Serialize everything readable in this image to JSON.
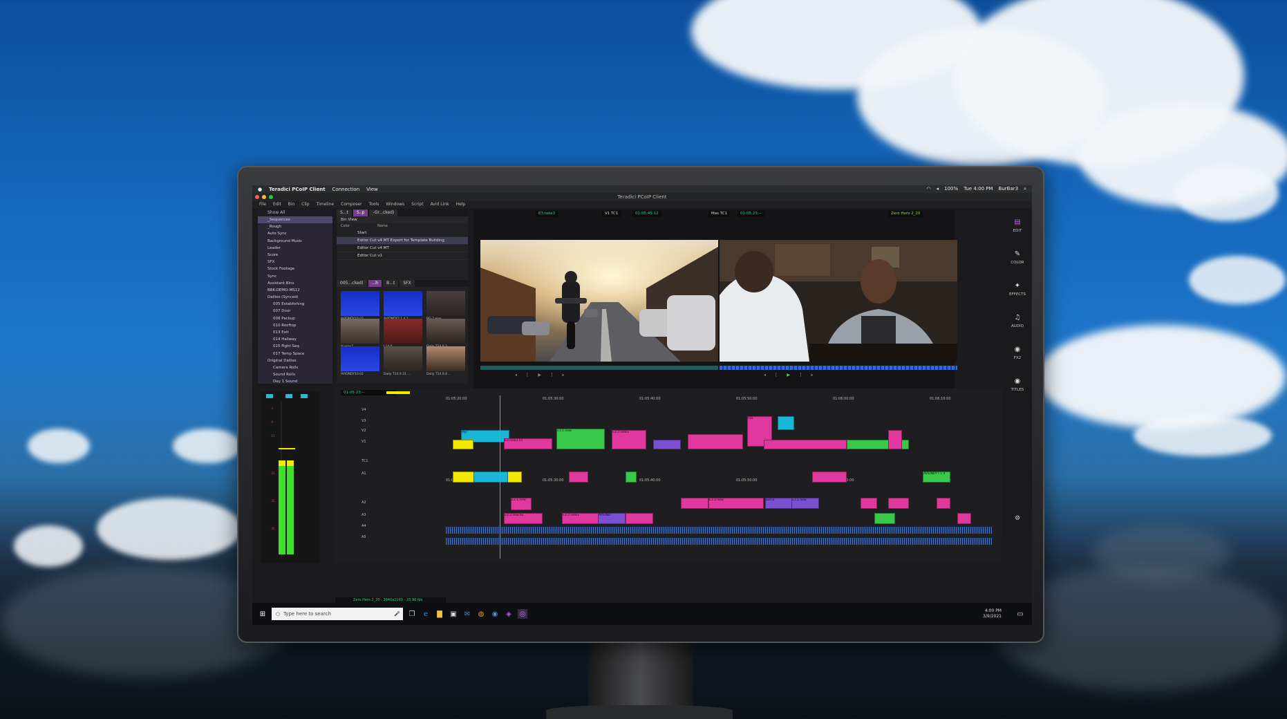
{
  "mac_menubar": {
    "app_name": "Teradici PCoIP Client",
    "items": [
      "Connection",
      "View"
    ],
    "battery": "100%",
    "clock": "Tue 4:00 PM",
    "user": "BurBar3"
  },
  "window_title": "Teradici PCoIP Client",
  "app_menu": [
    "File",
    "Edit",
    "Bin",
    "Clip",
    "Timeline",
    "Composer",
    "Tools",
    "Windows",
    "Script",
    "Avid Link",
    "Help"
  ],
  "project": {
    "dropdown": "Show All",
    "items": [
      "_Sequences",
      "_Rough",
      "Auto Sync",
      "Background Music",
      "Leader",
      "Score",
      "SFX",
      "Stock Footage",
      "Sync",
      "Assistant Bins",
      "BBK-DEMO-MS12",
      "Dailies (Synced)",
      "005 Establishing",
      "007 Door",
      "008 Packup",
      "010 Rooftop",
      "013 Exit",
      "014 Hallway",
      "015 Fight Seq",
      "017 Temp Space",
      "Original Dailies",
      "Camera Rolls",
      "Sound Rolls",
      "Day 1 Sound"
    ]
  },
  "bins_top": {
    "tabs": [
      "S...t",
      "S..p",
      "-Gr...cked)"
    ],
    "view": "Bin View",
    "columns": [
      "Color",
      "Name"
    ],
    "rows": [
      "Start",
      "Editor Cut v4 MT Export for Template Building",
      "Editor Cut v4 MT",
      "Editor Cut v1"
    ]
  },
  "bins_bottom": {
    "tabs": [
      "005...cked)",
      "...h",
      "B...t",
      "SFX"
    ],
    "thumbs": [
      "AVIDNDY10.02",
      "AVIDNDY2.1.4.1",
      "BG-2.wav",
      "Hi-wav2",
      "L14.0",
      "Daily T14.0.3",
      "AVIDNDY10.02",
      "Daily T14.0.31 ...",
      "Daily T14.0.4 ..."
    ]
  },
  "monitors": {
    "source_clip": "E3.take3",
    "source_tc_label": "V1 TC1",
    "source_tc": "01:05:45:12",
    "record_tc_label": "Mas TC1",
    "record_tc": "01:05:23:--",
    "sequence": "Zero Hero 2_20"
  },
  "rail": [
    "EDIT",
    "COLOR",
    "EFFECTS",
    "AUDIO",
    "FX2",
    "TITLES"
  ],
  "timeline": {
    "timecode": "01:05:23:--",
    "ruler": [
      "01:05:20:00",
      "01:05:30:00",
      "01:05:40:00",
      "01:05:50:00",
      "01:06:00:00",
      "01:06:10:00"
    ],
    "tracks": [
      "V4",
      "V3",
      "V2",
      "V1",
      "TC1",
      "A1",
      "A2",
      "A3",
      "A4",
      "A5"
    ],
    "clip_labels": [
      "MyI",
      "E3.new3.01",
      "E3.2.new3",
      "E3.1.new",
      "E3.1.new",
      "E3.2.new.02",
      "E3.2.new3",
      "AVIDND",
      "E3.2.new",
      "Siena",
      "E3.1.new",
      "AVIDNDY7.1.4",
      "Fos"
    ],
    "status": "Zero Hero 2_20 - 3840x2160 - 23.98 fps"
  },
  "taskbar": {
    "search_placeholder": "Type here to search",
    "time": "4:00 PM",
    "date": "3/9/2021"
  },
  "colors": {
    "accent_purple": "#7a3a8e",
    "clip_cyan": "#18b7d8",
    "clip_magenta": "#e0389c",
    "clip_green": "#3ac84a",
    "clip_violet": "#7a4fd0",
    "clip_yellow": "#f4e800",
    "timecode_green": "#2fd08a"
  }
}
